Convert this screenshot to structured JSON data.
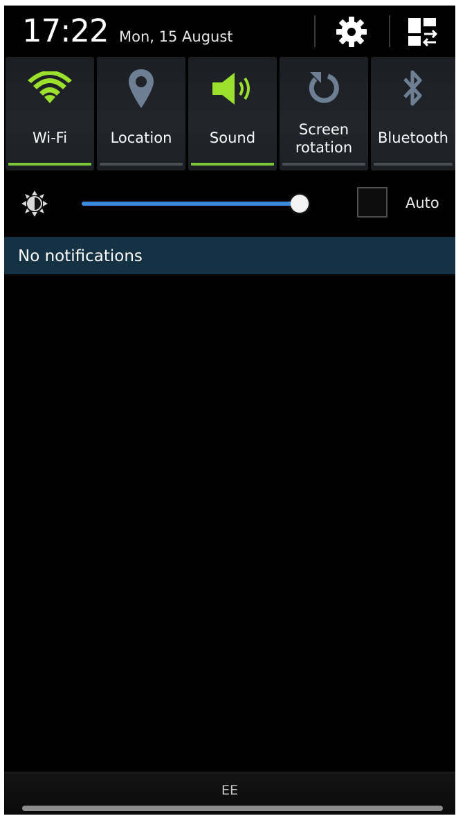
{
  "status": {
    "time": "17:22",
    "date": "Mon, 15 August"
  },
  "header": {
    "settings_icon": "gear-icon",
    "edit_toggles_icon": "grid-swap-icon"
  },
  "quick_toggles": [
    {
      "label": "Wi-Fi",
      "icon": "wifi-icon",
      "state": "on",
      "color": "#9be02c"
    },
    {
      "label": "Location",
      "icon": "location-pin-icon",
      "state": "off",
      "color": "#6e7f93"
    },
    {
      "label": "Sound",
      "icon": "speaker-icon",
      "state": "on",
      "color": "#9be02c"
    },
    {
      "label_line1": "Screen",
      "label_line2": "rotation",
      "icon": "rotate-icon",
      "state": "off",
      "color": "#6e7f93"
    },
    {
      "label": "Bluetooth",
      "icon": "bluetooth-icon",
      "state": "off",
      "color": "#6e7f93"
    }
  ],
  "brightness": {
    "icon": "brightness-icon",
    "level": 0.96,
    "auto_checked": false,
    "auto_label": "Auto"
  },
  "notifications": {
    "empty_text": "No notifications"
  },
  "footer": {
    "carrier": "EE"
  },
  "colors": {
    "active_green": "#9be02c",
    "inactive_icon": "#6e7f93",
    "slider_blue": "#3b89d8",
    "notification_bar": "#153244"
  }
}
